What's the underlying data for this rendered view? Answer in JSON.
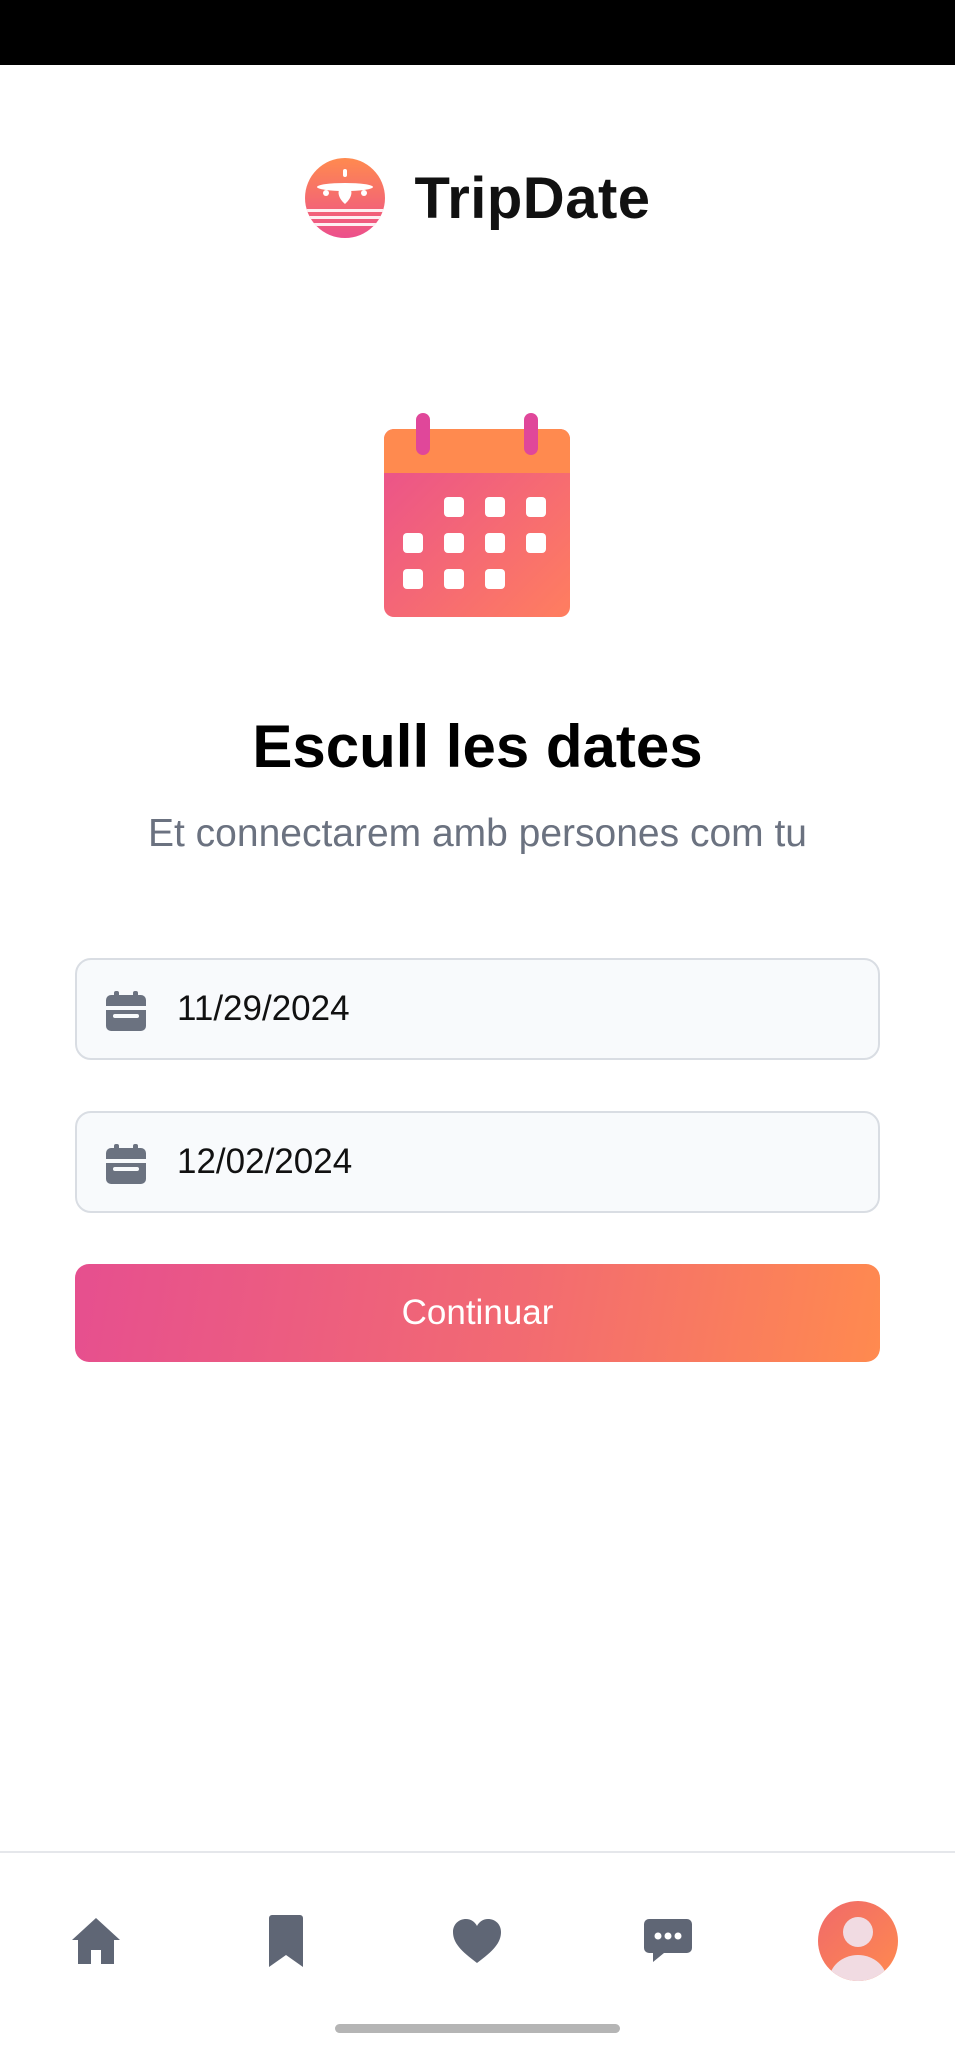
{
  "app": {
    "title": "TripDate"
  },
  "main": {
    "title": "Escull les dates",
    "subtitle": "Et connectarem amb persones com tu",
    "start_date": "11/29/2024",
    "end_date": "12/02/2024",
    "continue_label": "Continuar"
  },
  "bottom_nav": {
    "items": [
      {
        "name": "home",
        "icon": "home-icon"
      },
      {
        "name": "saved",
        "icon": "bookmark-icon"
      },
      {
        "name": "likes",
        "icon": "heart-icon"
      },
      {
        "name": "messages",
        "icon": "chat-icon"
      },
      {
        "name": "profile",
        "icon": "avatar"
      }
    ]
  },
  "colors": {
    "accent_pink": "#e64f8f",
    "accent_orange": "#ff8a4f",
    "icon_gray": "#6b7280",
    "subtitle_gray": "#6b7280"
  }
}
